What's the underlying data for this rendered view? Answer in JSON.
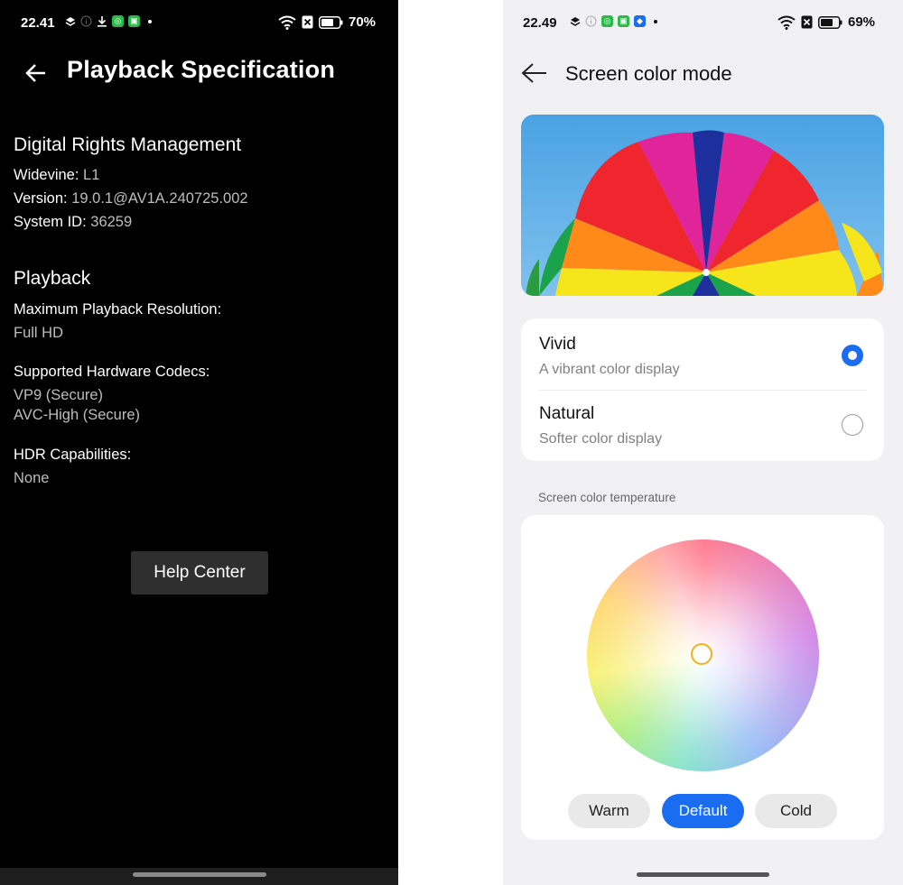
{
  "left": {
    "status": {
      "time": "22.41",
      "battery": "70%"
    },
    "title": "Playback Specification",
    "drm": {
      "heading": "Digital Rights Management",
      "widevine_label": "Widevine:",
      "widevine_value": "L1",
      "version_label": "Version:",
      "version_value": "19.0.1@AV1A.240725.002",
      "system_label": "System ID:",
      "system_value": "36259"
    },
    "playback": {
      "heading": "Playback",
      "max_res_label": "Maximum Playback Resolution:",
      "max_res_value": "Full HD",
      "codecs_label": "Supported Hardware Codecs:",
      "codecs": [
        "VP9 (Secure)",
        "AVC-High (Secure)"
      ],
      "hdr_label": "HDR Capabilities:",
      "hdr_value": "None"
    },
    "help_button": "Help Center"
  },
  "right": {
    "status": {
      "time": "22.49",
      "battery": "69%"
    },
    "title": "Screen color mode",
    "modes": [
      {
        "name": "Vivid",
        "desc": "A vibrant color display",
        "selected": true
      },
      {
        "name": "Natural",
        "desc": "Softer color display",
        "selected": false
      }
    ],
    "temp_label": "Screen color temperature",
    "presets": [
      {
        "label": "Warm",
        "selected": false
      },
      {
        "label": "Default",
        "selected": true
      },
      {
        "label": "Cold",
        "selected": false
      }
    ],
    "accent": "#1a6cf0"
  }
}
